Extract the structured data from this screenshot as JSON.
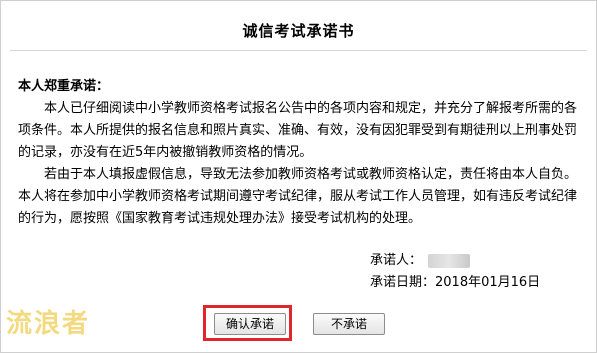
{
  "page": {
    "title": "诚信考试承诺书",
    "salutation": "本人郑重承诺：",
    "paragraphs": [
      "本人已仔细阅读中小学教师资格考试报名公告中的各项内容和规定，并充分了解报考所需的各项条件。本人所提供的报名信息和照片真实、准确、有效，没有因犯罪受到有期徒刑以上刑事处罚的记录，亦没有在近5年内被撤销教师资格的情况。",
      "若由于本人填报虚假信息，导致无法参加教师资格考试或教师资格认定，责任将由本人自负。本人将在参加中小学教师资格考试期间遵守考试纪律，服从考试工作人员管理，如有违反考试纪律的行为，愿按照《国家教育考试违规处理办法》接受考试机构的处理。"
    ],
    "signature": {
      "promiser_label": "承诺人：",
      "date_label": "承诺日期：",
      "date_value": "2018年01月16日"
    }
  },
  "actions": {
    "confirm_label": "确认承诺",
    "decline_label": "不承诺"
  },
  "watermark": {
    "text": "流浪者"
  },
  "colors": {
    "highlight": "#e0262a",
    "watermark": "#f2d36a"
  }
}
